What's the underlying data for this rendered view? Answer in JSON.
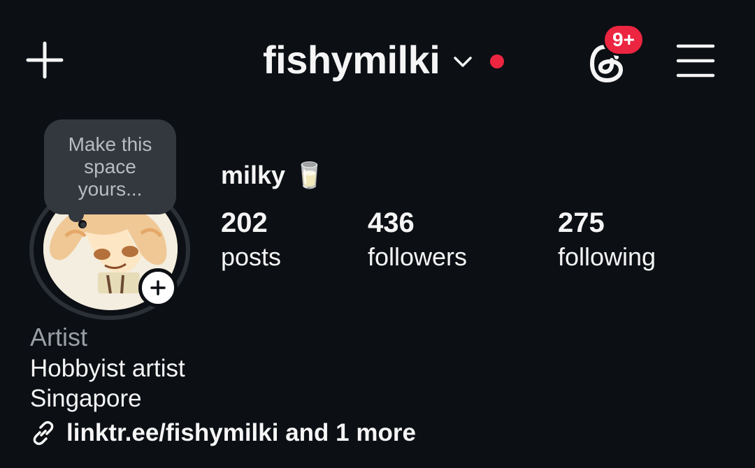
{
  "header": {
    "username": "fishymilki",
    "notification_badge": "9+",
    "icons": {
      "create": "plus-icon",
      "account_switch": "chevron-down-icon",
      "threads": "threads-icon",
      "menu": "hamburger-menu-icon"
    }
  },
  "profile": {
    "note_placeholder": "Make this space yours...",
    "display_name": "milky",
    "display_name_emoji": "🥛",
    "avatar_icon": "profile-picture"
  },
  "stats": [
    {
      "value": "202",
      "label": "posts"
    },
    {
      "value": "436",
      "label": "followers"
    },
    {
      "value": "275",
      "label": "following"
    }
  ],
  "bio": {
    "category": "Artist",
    "lines": [
      "Hobbyist artist",
      "Singapore"
    ],
    "link_text": "linktr.ee/fishymilki and 1 more"
  },
  "colors": {
    "background": "#0c0f14",
    "accent_red": "#ec2540",
    "text": "#f5f5f5",
    "muted": "#9a9ea6"
  }
}
